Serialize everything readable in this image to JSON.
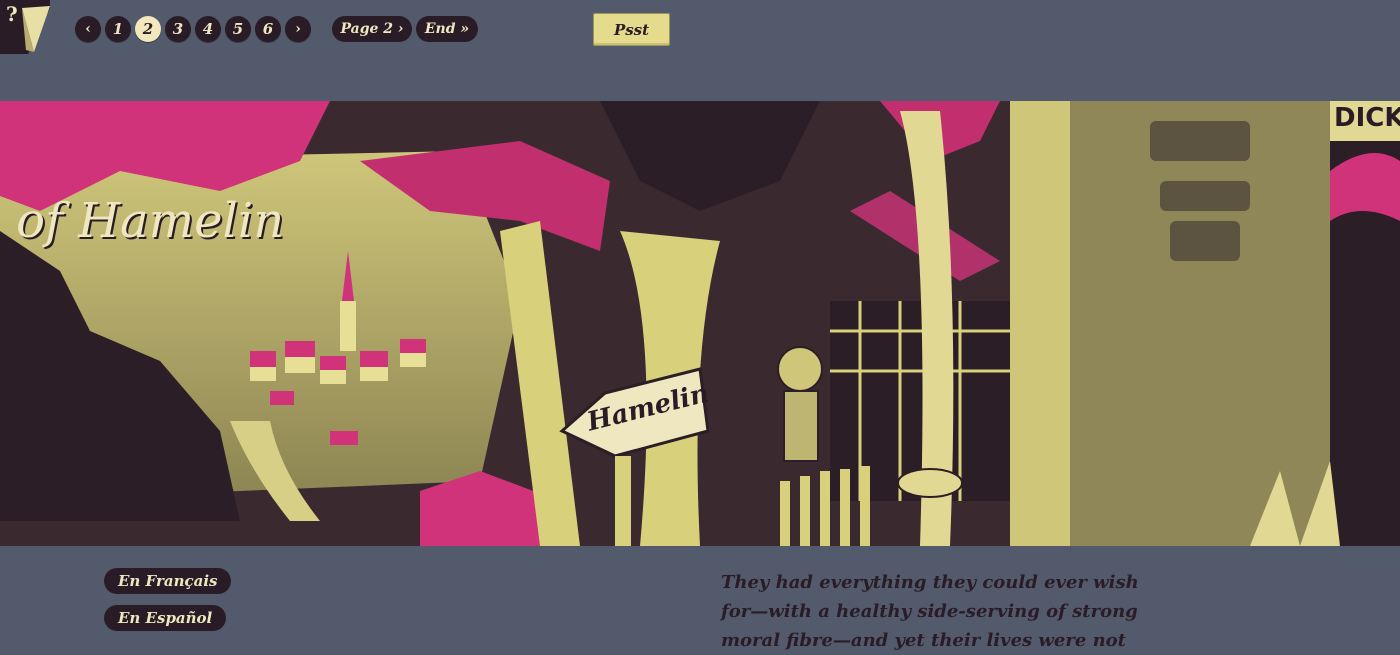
{
  "help": {
    "label": "?"
  },
  "pager": {
    "prev": "‹",
    "pages": [
      "1",
      "2",
      "3",
      "4",
      "5",
      "6"
    ],
    "current": "2",
    "next": "›"
  },
  "nav": {
    "page_label": "Page 2 ›",
    "end_label": "End »"
  },
  "psst": {
    "label": "Psst"
  },
  "banner": {
    "title_fragment": "n of Hamelin",
    "signpost": "Hamelin",
    "poster": "DICK"
  },
  "languages": {
    "french": "En Français",
    "spanish": "En Español"
  },
  "story": {
    "line1": "They had everything they could ever wish",
    "line2": "for—with a healthy side-serving of strong",
    "line3": "moral fibre—and yet their lives were not"
  },
  "colors": {
    "background": "#525a6b",
    "pill": "#2a1c26",
    "pill_text": "#efe7c0",
    "psst_button": "#e4dc8c",
    "magenta": "#d0337a",
    "yellow": "#d9d07c"
  }
}
